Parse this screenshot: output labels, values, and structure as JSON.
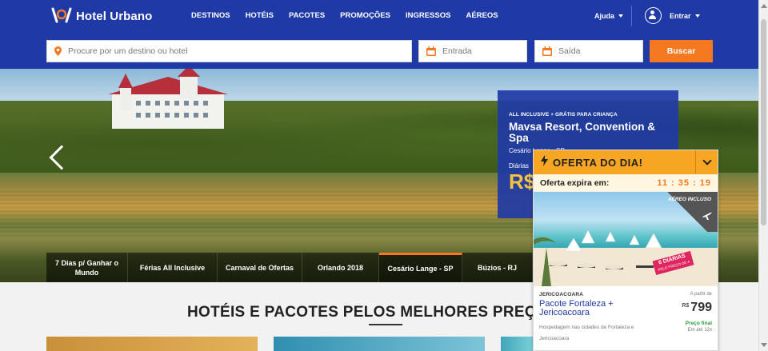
{
  "brand": {
    "name": "Hotel Urbano",
    "primary": "#1f3aa6",
    "accent": "#f47920"
  },
  "nav": {
    "items": [
      "DESTINOS",
      "HOTÉIS",
      "PACOTES",
      "PROMOÇÕES",
      "INGRESSOS",
      "AÉREOS"
    ],
    "help": "Ajuda",
    "login": "Entrar"
  },
  "search": {
    "destination_placeholder": "Procure por um destino ou hotel",
    "checkin_placeholder": "Entrada",
    "checkout_placeholder": "Saída",
    "button": "Buscar"
  },
  "hero": {
    "tag": "ALL INCLUSIVE + GRÁTIS PARA CRIANÇA",
    "title": "Mavsa Resort, Convention & Spa",
    "subtitle": "Cesário Lange - SP",
    "daily_label": "Diárias",
    "price_prefix": "R$",
    "tabs": [
      "7 Dias p/ Ganhar o Mundo",
      "Férias All Inclusive",
      "Carnaval de Ofertas",
      "Orlando 2018",
      "Cesário Lange - SP",
      "Búzios - RJ"
    ],
    "active_tab": 4
  },
  "section": {
    "headline": "HOTÉIS E PACOTES PELOS MELHORES PREÇOS"
  },
  "offer": {
    "title": "OFERTA DO DIA!",
    "expire_label": "Oferta expira em:",
    "timer": "11 : 35 : 19",
    "badge": "AÉREO INCLUSO",
    "diarias": "6 DIÁRIAS",
    "diarias_sub": "PELO PREÇO DE 4",
    "destination": "JERICOACOARA",
    "from_label": "A partir de",
    "package_title": "Pacote Fortaleza + Jericoacoara",
    "currency": "R$",
    "price": "799",
    "price_final": "Preço final",
    "installments": "Em até 12x",
    "description": "Hospedagem nas cidades de Fortaleza e Jericoacoara"
  }
}
